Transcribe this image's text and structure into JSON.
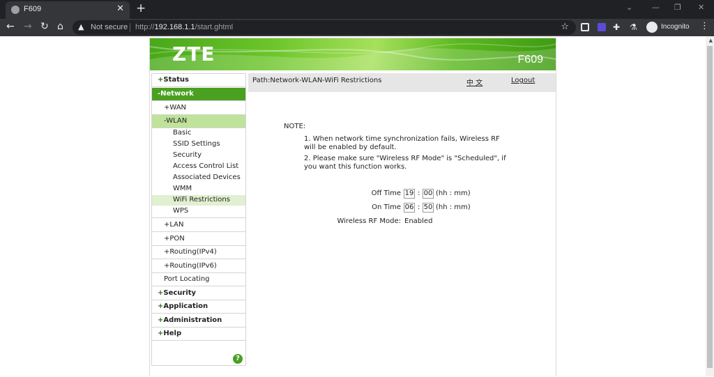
{
  "browser": {
    "tab_title": "F609",
    "not_secure": "Not secure",
    "url_scheme": "http://",
    "url_host": "192.168.1.1",
    "url_path": "/start.ghtml",
    "profile_label": "Incognito"
  },
  "banner": {
    "logo": "ZTE",
    "model": "F609"
  },
  "menu": {
    "status": "Status",
    "network": "-Network",
    "wan": "+WAN",
    "wlan": "-WLAN",
    "basic": "Basic",
    "ssid_settings": "SSID Settings",
    "security_sub": "Security",
    "access_control_list": "Access Control List",
    "associated_devices": "Associated Devices",
    "wmm": "WMM",
    "wifi_restrictions": "WiFi Restrictions",
    "wps": "WPS",
    "lan": "+LAN",
    "pon": "+PON",
    "routing_ipv4": "+Routing(IPv4)",
    "routing_ipv6": "+Routing(IPv6)",
    "port_locating": "Port Locating",
    "security": "Security",
    "application": "Application",
    "administration": "Administration",
    "help": "Help"
  },
  "content": {
    "path": "Path:Network-WLAN-WiFi Restrictions",
    "lang": "中 文",
    "logout": "Logout",
    "note_title": "NOTE:",
    "note_1": "1. When network time synchronization fails, Wireless RF will be enabled by default.",
    "note_2": "2. Please make sure \"Wireless RF Mode\" is \"Scheduled\", if you want this function works.",
    "off_time_label": "Off Time",
    "off_hh": "19",
    "off_mm": "00",
    "on_time_label": "On Time",
    "on_hh": "06",
    "on_mm": "50",
    "unit": "(hh : mm)",
    "rf_mode_label": "Wireless RF Mode:",
    "rf_mode_value": "Enabled"
  },
  "colors": {
    "brand_green": "#4aa020",
    "submenu_active": "#bfe39a"
  }
}
